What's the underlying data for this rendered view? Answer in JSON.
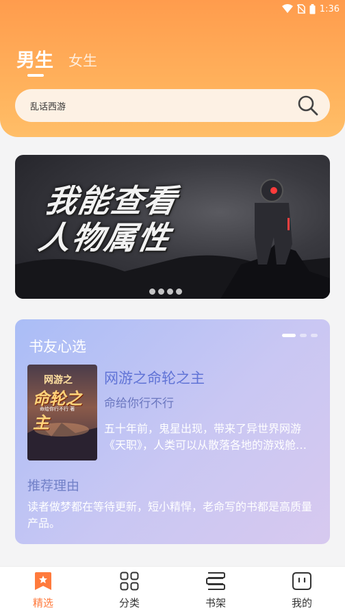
{
  "status": {
    "time": "1:36"
  },
  "tabs": {
    "male": "男生",
    "female": "女生"
  },
  "search": {
    "placeholder": "乱话西游"
  },
  "banner": {
    "title_line1": "我能查看",
    "title_line2": "人物属性"
  },
  "pick": {
    "title": "书友心选",
    "book": {
      "cover_top": "网游之",
      "cover_main": "命轮之主",
      "cover_author": "命给你行不行 著",
      "name": "网游之命轮之主",
      "author": "命给你行不行",
      "desc": "五十年前，鬼星出现，带来了异世界网游《天职》，人类可以从散落各地的游戏舱进入游戏……"
    },
    "reason_label": "推荐理由",
    "reason": "读者做梦都在等待更新，短小精悍，老命写的书都是高质量产品。"
  },
  "nav": [
    {
      "label": "精选",
      "icon": "bookmark-icon",
      "active": true
    },
    {
      "label": "分类",
      "icon": "grid-icon",
      "active": false
    },
    {
      "label": "书架",
      "icon": "bookshelf-icon",
      "active": false
    },
    {
      "label": "我的",
      "icon": "profile-face-icon",
      "active": false
    }
  ],
  "colors": {
    "accent": "#ff7a3c",
    "header": "#ffa552",
    "card_blue": "#aabdf6"
  }
}
